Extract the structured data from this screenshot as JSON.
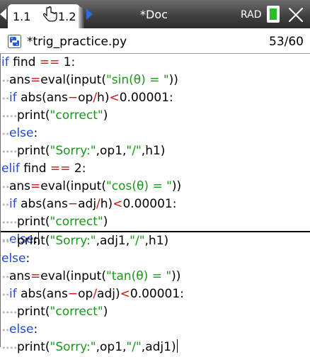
{
  "tabbar": {
    "tab1_label": "1.1",
    "tab2_label": "1.2",
    "doc_title": "*Doc",
    "angle_mode": "RAD",
    "icons": [
      "nav-left-icon",
      "hand-cursor-icon",
      "nav-right-icon",
      "battery-icon",
      "close-icon"
    ]
  },
  "file": {
    "name": "*trig_practice.py",
    "line_position": "53/60",
    "icon": "python-icon"
  },
  "colors": {
    "keyword": "#1e4bd2",
    "operator": "#d11010",
    "string": "#1a961a",
    "battery": "#22c322"
  },
  "pane_top": [
    {
      "i": "",
      "t": [
        [
          "kw",
          "if"
        ],
        [
          "n",
          " find "
        ],
        [
          "op",
          "=="
        ],
        [
          "n",
          " 1:"
        ]
      ]
    },
    {
      "i": "••",
      "t": [
        [
          "n",
          "ans"
        ],
        [
          "op",
          "="
        ],
        [
          "n",
          "eval(input("
        ],
        [
          "str",
          "\"sin(θ) = \""
        ],
        [
          "n",
          "))"
        ]
      ]
    },
    {
      "i": "••",
      "t": [
        [
          "kw",
          "if"
        ],
        [
          "n",
          " abs(ans"
        ],
        [
          "op",
          "−"
        ],
        [
          "n",
          "op"
        ],
        [
          "op",
          "/"
        ],
        [
          "n",
          "h)"
        ],
        [
          "op",
          "<"
        ],
        [
          "n",
          "0.00001:"
        ]
      ]
    },
    {
      "i": "••••",
      "t": [
        [
          "n",
          "print("
        ],
        [
          "str",
          "\"correct\""
        ],
        [
          "n",
          ")"
        ]
      ]
    },
    {
      "i": "••",
      "t": [
        [
          "kw",
          "else"
        ],
        [
          "n",
          ":"
        ]
      ]
    },
    {
      "i": "••••",
      "t": [
        [
          "n",
          "print("
        ],
        [
          "str",
          "\"Sorry:\""
        ],
        [
          "n",
          ",op1,"
        ],
        [
          "str",
          "\"/\""
        ],
        [
          "n",
          ",h1)"
        ]
      ]
    },
    {
      "i": "",
      "t": [
        [
          "kw",
          "elif"
        ],
        [
          "n",
          " find "
        ],
        [
          "op",
          "=="
        ],
        [
          "n",
          " 2:"
        ]
      ]
    },
    {
      "i": "••",
      "t": [
        [
          "n",
          "ans"
        ],
        [
          "op",
          "="
        ],
        [
          "n",
          "eval(input("
        ],
        [
          "str",
          "\"cos(θ) = \""
        ],
        [
          "n",
          "))"
        ]
      ]
    },
    {
      "i": "••",
      "t": [
        [
          "kw",
          "if"
        ],
        [
          "n",
          " abs(ans"
        ],
        [
          "op",
          "−"
        ],
        [
          "n",
          "adj"
        ],
        [
          "op",
          "/"
        ],
        [
          "n",
          "h)"
        ],
        [
          "op",
          "<"
        ],
        [
          "n",
          "0.00001:"
        ]
      ]
    },
    {
      "i": "••••",
      "t": [
        [
          "n",
          "print("
        ],
        [
          "str",
          "\"correct\""
        ],
        [
          "n",
          ")"
        ]
      ]
    },
    {
      "i": "••",
      "t": [
        [
          "kw",
          "else"
        ],
        [
          "n",
          ":"
        ]
      ],
      "caret": true
    }
  ],
  "pane_bottom": [
    {
      "i": "••••",
      "t": [
        [
          "n",
          "print("
        ],
        [
          "str",
          "\"Sorry:\""
        ],
        [
          "n",
          ",adj1,"
        ],
        [
          "str",
          "\"/\""
        ],
        [
          "n",
          ",h1)"
        ]
      ]
    },
    {
      "i": "",
      "t": [
        [
          "kw",
          "else"
        ],
        [
          "n",
          ":"
        ]
      ]
    },
    {
      "i": "••",
      "t": [
        [
          "n",
          "ans"
        ],
        [
          "op",
          "="
        ],
        [
          "n",
          "eval(input("
        ],
        [
          "str",
          "\"tan(θ) = \""
        ],
        [
          "n",
          "))"
        ]
      ]
    },
    {
      "i": "••",
      "t": [
        [
          "kw",
          "if"
        ],
        [
          "n",
          " abs(ans"
        ],
        [
          "op",
          "−"
        ],
        [
          "n",
          "op"
        ],
        [
          "op",
          "/"
        ],
        [
          "n",
          "adj)"
        ],
        [
          "op",
          "<"
        ],
        [
          "n",
          "0.00001:"
        ]
      ]
    },
    {
      "i": "••••",
      "t": [
        [
          "n",
          "print("
        ],
        [
          "str",
          "\"correct\""
        ],
        [
          "n",
          ")"
        ]
      ]
    },
    {
      "i": "••",
      "t": [
        [
          "kw",
          "else"
        ],
        [
          "n",
          ":"
        ]
      ]
    },
    {
      "i": "••••",
      "t": [
        [
          "n",
          "print("
        ],
        [
          "str",
          "\"Sorry:\""
        ],
        [
          "n",
          ",op1,"
        ],
        [
          "str",
          "\"/\""
        ],
        [
          "n",
          ",adj1)"
        ]
      ],
      "caret": true
    }
  ]
}
